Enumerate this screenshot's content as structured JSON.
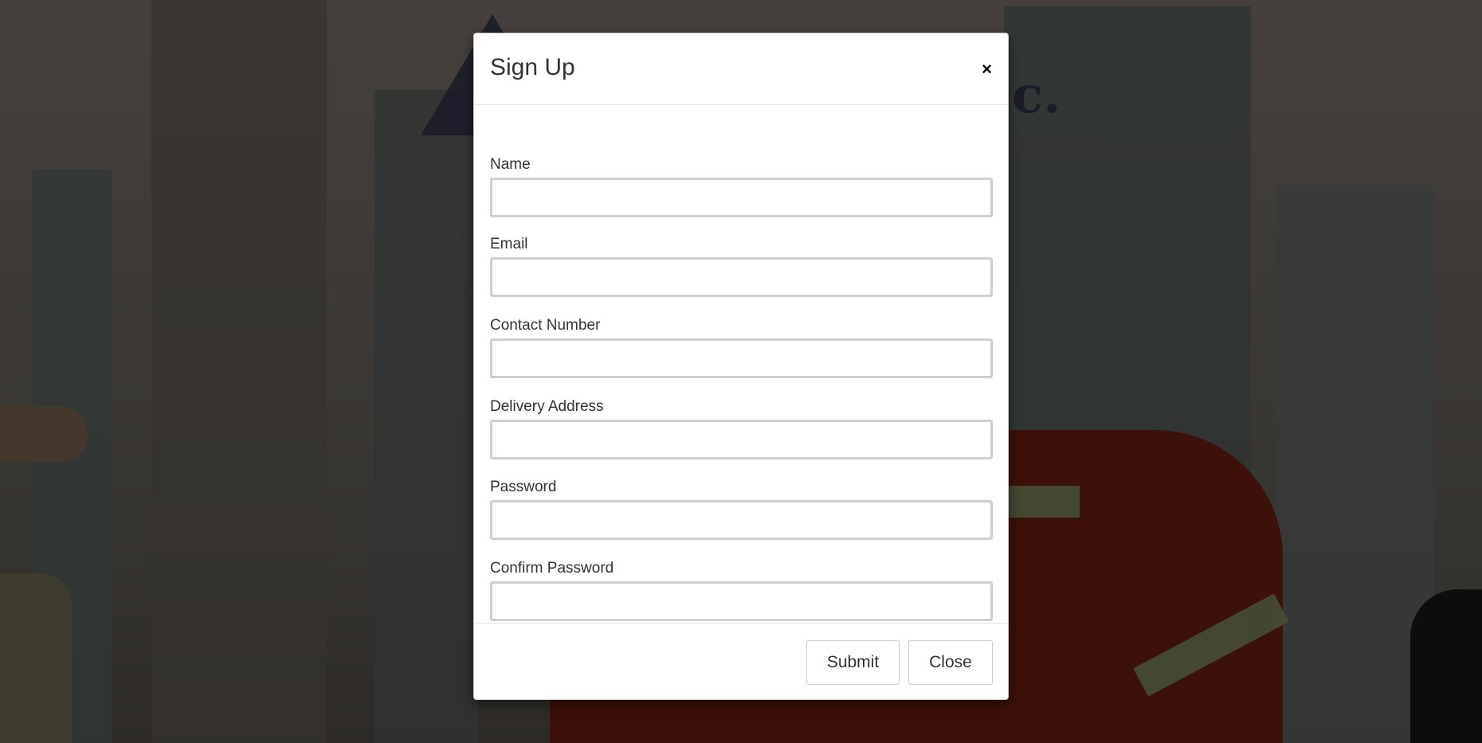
{
  "modal": {
    "title": "Sign Up",
    "close_glyph": "×",
    "fields": [
      {
        "label": "Name",
        "value": "",
        "placeholder": ""
      },
      {
        "label": "Email",
        "value": "",
        "placeholder": ""
      },
      {
        "label": "Contact Number",
        "value": "",
        "placeholder": ""
      },
      {
        "label": "Delivery Address",
        "value": "",
        "placeholder": ""
      },
      {
        "label": "Password",
        "value": "",
        "placeholder": ""
      },
      {
        "label": "Confirm Password",
        "value": "",
        "placeholder": ""
      }
    ],
    "buttons": {
      "submit_label": "Submit",
      "close_label": "Close"
    }
  },
  "background": {
    "logo_text": "c.",
    "icon": "triangle-logo-icon"
  },
  "colors": {
    "overlay": "#000000",
    "modal_bg": "#ffffff",
    "input_border": "#cfcfcf",
    "text": "#333333"
  }
}
